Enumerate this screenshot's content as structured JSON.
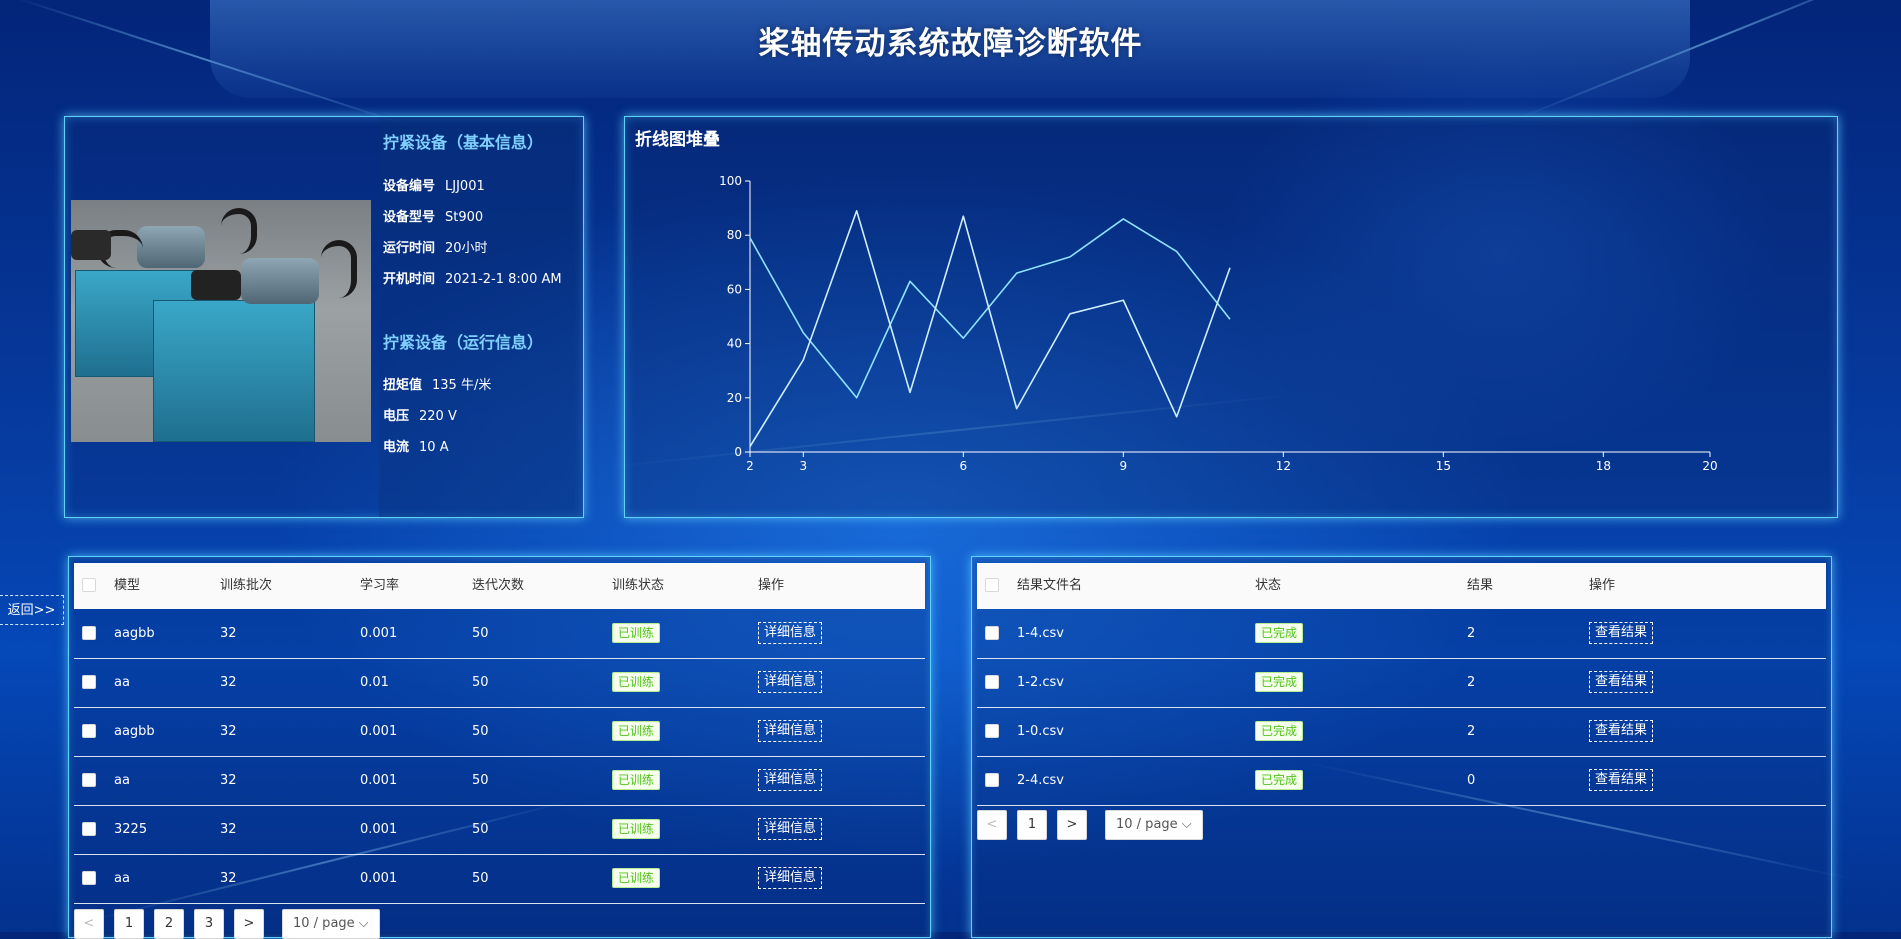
{
  "app": {
    "title": "桨轴传动系统故障诊断软件",
    "back_label": "返回>>"
  },
  "basic_info": {
    "title": "拧紧设备（基本信息）",
    "fields": [
      {
        "label": "设备编号",
        "value": "LJJ001"
      },
      {
        "label": "设备型号",
        "value": "St900"
      },
      {
        "label": "运行时间",
        "value": "20小时"
      },
      {
        "label": "开机时间",
        "value": "2021-2-1 8:00 AM"
      }
    ]
  },
  "run_info": {
    "title": "拧紧设备（运行信息）",
    "fields": [
      {
        "label": "扭矩值",
        "value": "135 牛/米"
      },
      {
        "label": "电压",
        "value": "220 V"
      },
      {
        "label": "电流",
        "value": "10 A"
      }
    ]
  },
  "chart_data": {
    "type": "line",
    "title": "折线图堆叠",
    "xlim": [
      2,
      20
    ],
    "ylim": [
      0,
      100
    ],
    "x_ticks": [
      2,
      3,
      6,
      9,
      12,
      15,
      18,
      20
    ],
    "y_ticks": [
      0,
      20,
      40,
      60,
      80,
      100
    ],
    "grid": false,
    "series": [
      {
        "x": [
          2,
          3,
          4,
          5,
          6,
          7,
          8,
          9,
          10,
          11
        ],
        "values": [
          79,
          44,
          20,
          63,
          42,
          66,
          72,
          86,
          74,
          49
        ],
        "color": "#8fe3ff"
      },
      {
        "x": [
          2,
          3,
          4,
          5,
          6,
          7,
          8,
          9,
          10,
          11
        ],
        "values": [
          2,
          34,
          89,
          22,
          87,
          16,
          51,
          56,
          13,
          68
        ],
        "color": "#cfeeff"
      }
    ]
  },
  "models_table": {
    "columns": [
      "模型",
      "训练批次",
      "学习率",
      "迭代次数",
      "训练状态",
      "操作"
    ],
    "rows": [
      {
        "model": "aagbb",
        "batch": "32",
        "lr": "0.001",
        "iters": "50",
        "status": "已训练",
        "action": "详细信息"
      },
      {
        "model": "aa",
        "batch": "32",
        "lr": "0.01",
        "iters": "50",
        "status": "已训练",
        "action": "详细信息"
      },
      {
        "model": "aagbb",
        "batch": "32",
        "lr": "0.001",
        "iters": "50",
        "status": "已训练",
        "action": "详细信息"
      },
      {
        "model": "aa",
        "batch": "32",
        "lr": "0.001",
        "iters": "50",
        "status": "已训练",
        "action": "详细信息"
      },
      {
        "model": "3225",
        "batch": "32",
        "lr": "0.001",
        "iters": "50",
        "status": "已训练",
        "action": "详细信息"
      },
      {
        "model": "aa",
        "batch": "32",
        "lr": "0.001",
        "iters": "50",
        "status": "已训练",
        "action": "详细信息"
      }
    ],
    "pagination": {
      "prev": "<",
      "pages": [
        "1",
        "2",
        "3"
      ],
      "next": ">",
      "page_size": "10 / page"
    }
  },
  "results_table": {
    "columns": [
      "结果文件名",
      "状态",
      "结果",
      "操作"
    ],
    "rows": [
      {
        "file": "1-4.csv",
        "status": "已完成",
        "result": "2",
        "action": "查看结果"
      },
      {
        "file": "1-2.csv",
        "status": "已完成",
        "result": "2",
        "action": "查看结果"
      },
      {
        "file": "1-0.csv",
        "status": "已完成",
        "result": "2",
        "action": "查看结果"
      },
      {
        "file": "2-4.csv",
        "status": "已完成",
        "result": "0",
        "action": "查看结果"
      }
    ],
    "pagination": {
      "prev": "<",
      "pages": [
        "1"
      ],
      "next": ">",
      "page_size": "10 / page"
    }
  }
}
